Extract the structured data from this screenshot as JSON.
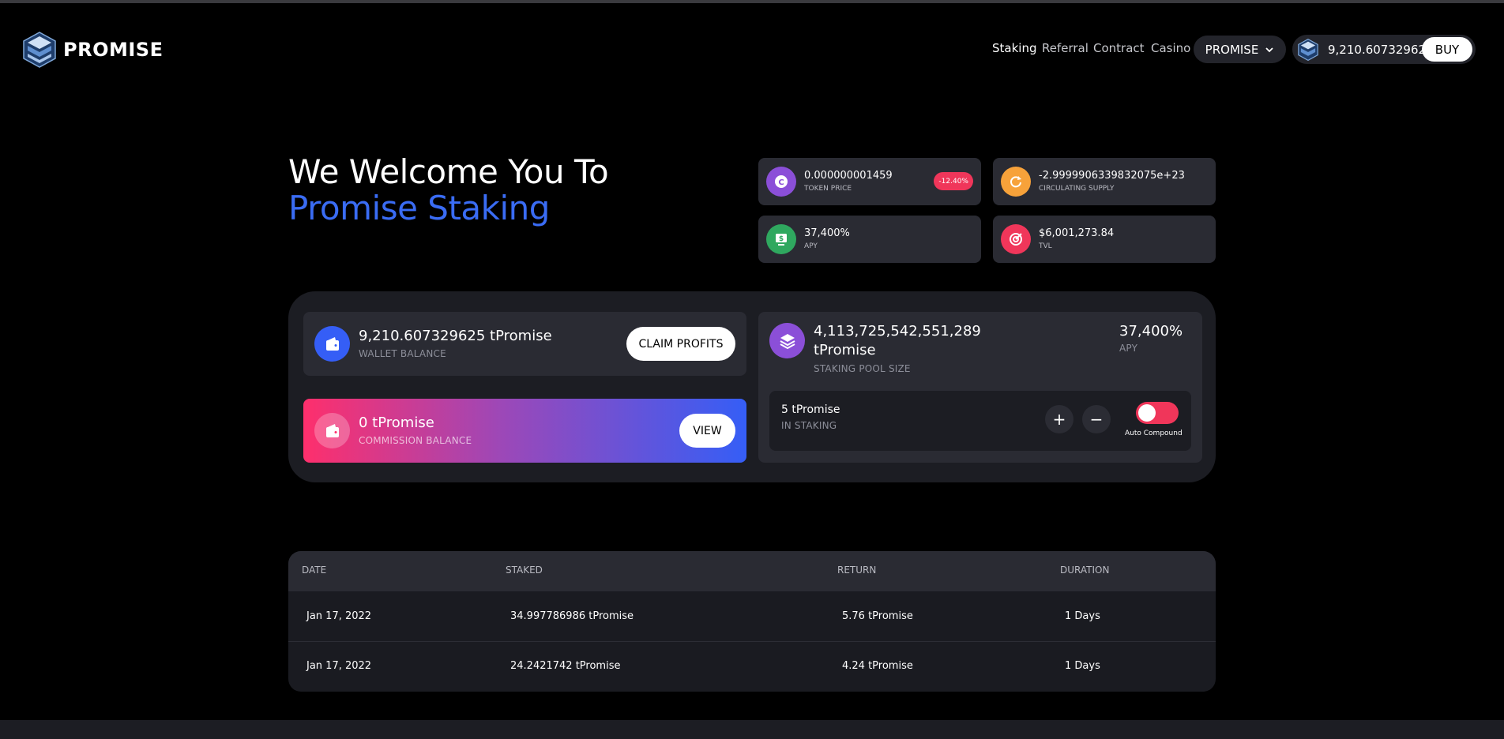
{
  "brand": {
    "name": "PROMISE"
  },
  "nav": {
    "links": [
      "Staking",
      "Referral",
      "Contract",
      "Casino"
    ],
    "token_select": "PROMISE",
    "wallet_amount": "9,210.607329625",
    "buy_label": "BUY"
  },
  "hero": {
    "line1": "We Welcome You To",
    "line2": "Promise Staking"
  },
  "stats": {
    "token_price": {
      "value": "0.000000001459",
      "label": "TOKEN PRICE",
      "change": "-12.40%"
    },
    "circulating": {
      "value": "-2.9999906339832075e+23",
      "label": "CIRCULATING SUPPLY"
    },
    "apy": {
      "value": "37,400%",
      "label": "APY"
    },
    "tvl": {
      "value": "$6,001,273.84",
      "label": "TVL"
    }
  },
  "wallet": {
    "amount": "9,210.607329625 tPromise",
    "label": "WALLET BALANCE",
    "claim_label": "CLAIM PROFITS"
  },
  "commission": {
    "amount": "0 tPromise",
    "label": "COMMISSION BALANCE",
    "view_label": "VIEW"
  },
  "pool": {
    "size_line1": "4,113,725,542,551,289",
    "size_line2": "tPromise",
    "label": "STAKING POOL SIZE",
    "apy": "37,400%",
    "apy_label": "APY"
  },
  "staking": {
    "amount": "5 tPromise",
    "label": "IN STAKING",
    "plus": "+",
    "minus": "−",
    "auto_compound_label": "Auto Compound",
    "auto_compound_on": true
  },
  "table": {
    "headers": [
      "DATE",
      "STAKED",
      "RETURN",
      "DURATION"
    ],
    "rows": [
      [
        "Jan 17, 2022",
        "34.997786986 tPromise",
        "5.76 tPromise",
        "1 Days"
      ],
      [
        "Jan 17, 2022",
        "24.2421742 tPromise",
        "4.24 tPromise",
        "1 Days"
      ]
    ]
  },
  "colors": {
    "accent_blue": "#3a6cf4",
    "accent_pink": "#f0365a",
    "purple": "#8b4fd8",
    "orange": "#f7a23a",
    "green": "#2fa85f"
  },
  "icons": [
    "promise-logo",
    "chevron-down-icon",
    "coin-icon",
    "refresh-icon",
    "dollar-monitor-icon",
    "target-icon",
    "wallet-icon",
    "layers-icon",
    "plus-icon",
    "minus-icon"
  ]
}
